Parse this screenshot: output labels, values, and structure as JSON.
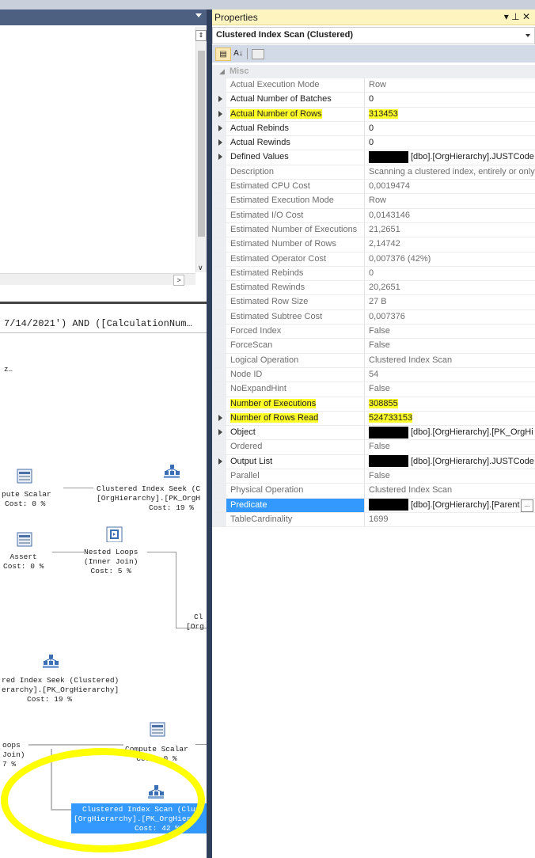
{
  "panel": {
    "title": "Properties",
    "controls": "▾ ⊥ ✕",
    "object_selector": "Clustered Index Scan (Clustered)",
    "toolbar": {
      "categorized": "▤",
      "alphabetical": "A↓",
      "pages": "▭"
    }
  },
  "category": {
    "label": "Misc",
    "expander": "◢"
  },
  "rows": [
    {
      "name": "Actual Execution Mode",
      "value": "Row",
      "expandable": false,
      "bold": false
    },
    {
      "name": "Actual Number of Batches",
      "value": "0",
      "expandable": true,
      "bold": true
    },
    {
      "name": "Actual Number of Rows",
      "value": "313453",
      "expandable": true,
      "bold": true,
      "highlight": true
    },
    {
      "name": "Actual Rebinds",
      "value": "0",
      "expandable": true,
      "bold": true
    },
    {
      "name": "Actual Rewinds",
      "value": "0",
      "expandable": true,
      "bold": true
    },
    {
      "name": "Defined Values",
      "value": "[dbo].[OrgHierarchy].JUSTCode",
      "expandable": true,
      "bold": true,
      "redacted": true
    },
    {
      "name": "Description",
      "value": "Scanning a clustered index, entirely or only",
      "expandable": false,
      "bold": false
    },
    {
      "name": "Estimated CPU Cost",
      "value": "0,0019474",
      "expandable": false,
      "bold": false
    },
    {
      "name": "Estimated Execution Mode",
      "value": "Row",
      "expandable": false,
      "bold": false
    },
    {
      "name": "Estimated I/O Cost",
      "value": "0,0143146",
      "expandable": false,
      "bold": false
    },
    {
      "name": "Estimated Number of Executions",
      "value": "21,2651",
      "expandable": false,
      "bold": false
    },
    {
      "name": "Estimated Number of Rows",
      "value": "2,14742",
      "expandable": false,
      "bold": false
    },
    {
      "name": "Estimated Operator Cost",
      "value": "0,007376 (42%)",
      "expandable": false,
      "bold": false
    },
    {
      "name": "Estimated Rebinds",
      "value": "0",
      "expandable": false,
      "bold": false
    },
    {
      "name": "Estimated Rewinds",
      "value": "20,2651",
      "expandable": false,
      "bold": false
    },
    {
      "name": "Estimated Row Size",
      "value": "27 B",
      "expandable": false,
      "bold": false
    },
    {
      "name": "Estimated Subtree Cost",
      "value": "0,007376",
      "expandable": false,
      "bold": false
    },
    {
      "name": "Forced Index",
      "value": "False",
      "expandable": false,
      "bold": false
    },
    {
      "name": "ForceScan",
      "value": "False",
      "expandable": false,
      "bold": false
    },
    {
      "name": "Logical Operation",
      "value": "Clustered Index Scan",
      "expandable": false,
      "bold": false
    },
    {
      "name": "Node ID",
      "value": "54",
      "expandable": false,
      "bold": false
    },
    {
      "name": "NoExpandHint",
      "value": "False",
      "expandable": false,
      "bold": false
    },
    {
      "name": "Number of Executions",
      "value": "308855",
      "expandable": false,
      "bold": false,
      "highlight": true
    },
    {
      "name": "Number of Rows Read",
      "value": "524733153",
      "expandable": true,
      "bold": true,
      "highlight": true
    },
    {
      "name": "Object",
      "value": "[dbo].[OrgHierarchy].[PK_OrgHi",
      "expandable": true,
      "bold": true,
      "redacted": true
    },
    {
      "name": "Ordered",
      "value": "False",
      "expandable": false,
      "bold": false
    },
    {
      "name": "Output List",
      "value": "[dbo].[OrgHierarchy].JUSTCode",
      "expandable": true,
      "bold": true,
      "redacted": true
    },
    {
      "name": "Parallel",
      "value": "False",
      "expandable": false,
      "bold": false
    },
    {
      "name": "Physical Operation",
      "value": "Clustered Index Scan",
      "expandable": false,
      "bold": false
    },
    {
      "name": "Predicate",
      "value": "[dbo].[OrgHierarchy].[Parent",
      "expandable": false,
      "bold": true,
      "redacted": true,
      "selected": true,
      "ellipsis_button": "..."
    },
    {
      "name": "TableCardinality",
      "value": "1699",
      "expandable": false,
      "bold": false
    }
  ],
  "editor": {
    "query_snippet": "7/14/2021') AND ([CalculationNum…",
    "truncated_label": "z…",
    "split_glyph": "⇕",
    "scroll_right": ">",
    "scroll_down": "∨"
  },
  "plan": {
    "compute_scalar_1": {
      "name": "pute Scalar",
      "cost": "Cost: 0 %"
    },
    "clustered_seek_1": {
      "line1": "Clustered Index Seek (C",
      "line2": "[OrgHierarchy].[PK_OrgH",
      "cost": "Cost: 19 %"
    },
    "assert": {
      "name": "Assert",
      "cost": "Cost: 0 %"
    },
    "nested_loops": {
      "line1": "Nested Loops",
      "line2": "(Inner Join)",
      "cost": "Cost: 5 %"
    },
    "partial_cl": {
      "line1": "Cl",
      "line2": "[Org"
    },
    "clustered_seek_2": {
      "line1": "red Index Seek (Clustered)",
      "line2": "erarchy].[PK_OrgHierarchy]",
      "cost": "Cost: 19 %"
    },
    "loops_partial": {
      "line1": "oops",
      "line2": "Join)",
      "cost": "7 %"
    },
    "compute_scalar_2": {
      "name": "Compute Scalar",
      "cost": "Cost: 0 %"
    },
    "clustered_scan": {
      "line1": "Clustered Index Scan (Clus",
      "line2": "[OrgHierarchy].[PK_OrgHier",
      "cost": "Cost: 42 %"
    }
  },
  "colors": {
    "highlight": "#ffff2a",
    "selection": "#3399ff",
    "title_bar": "#fdf4bf",
    "divider": "#2f3f5c"
  }
}
